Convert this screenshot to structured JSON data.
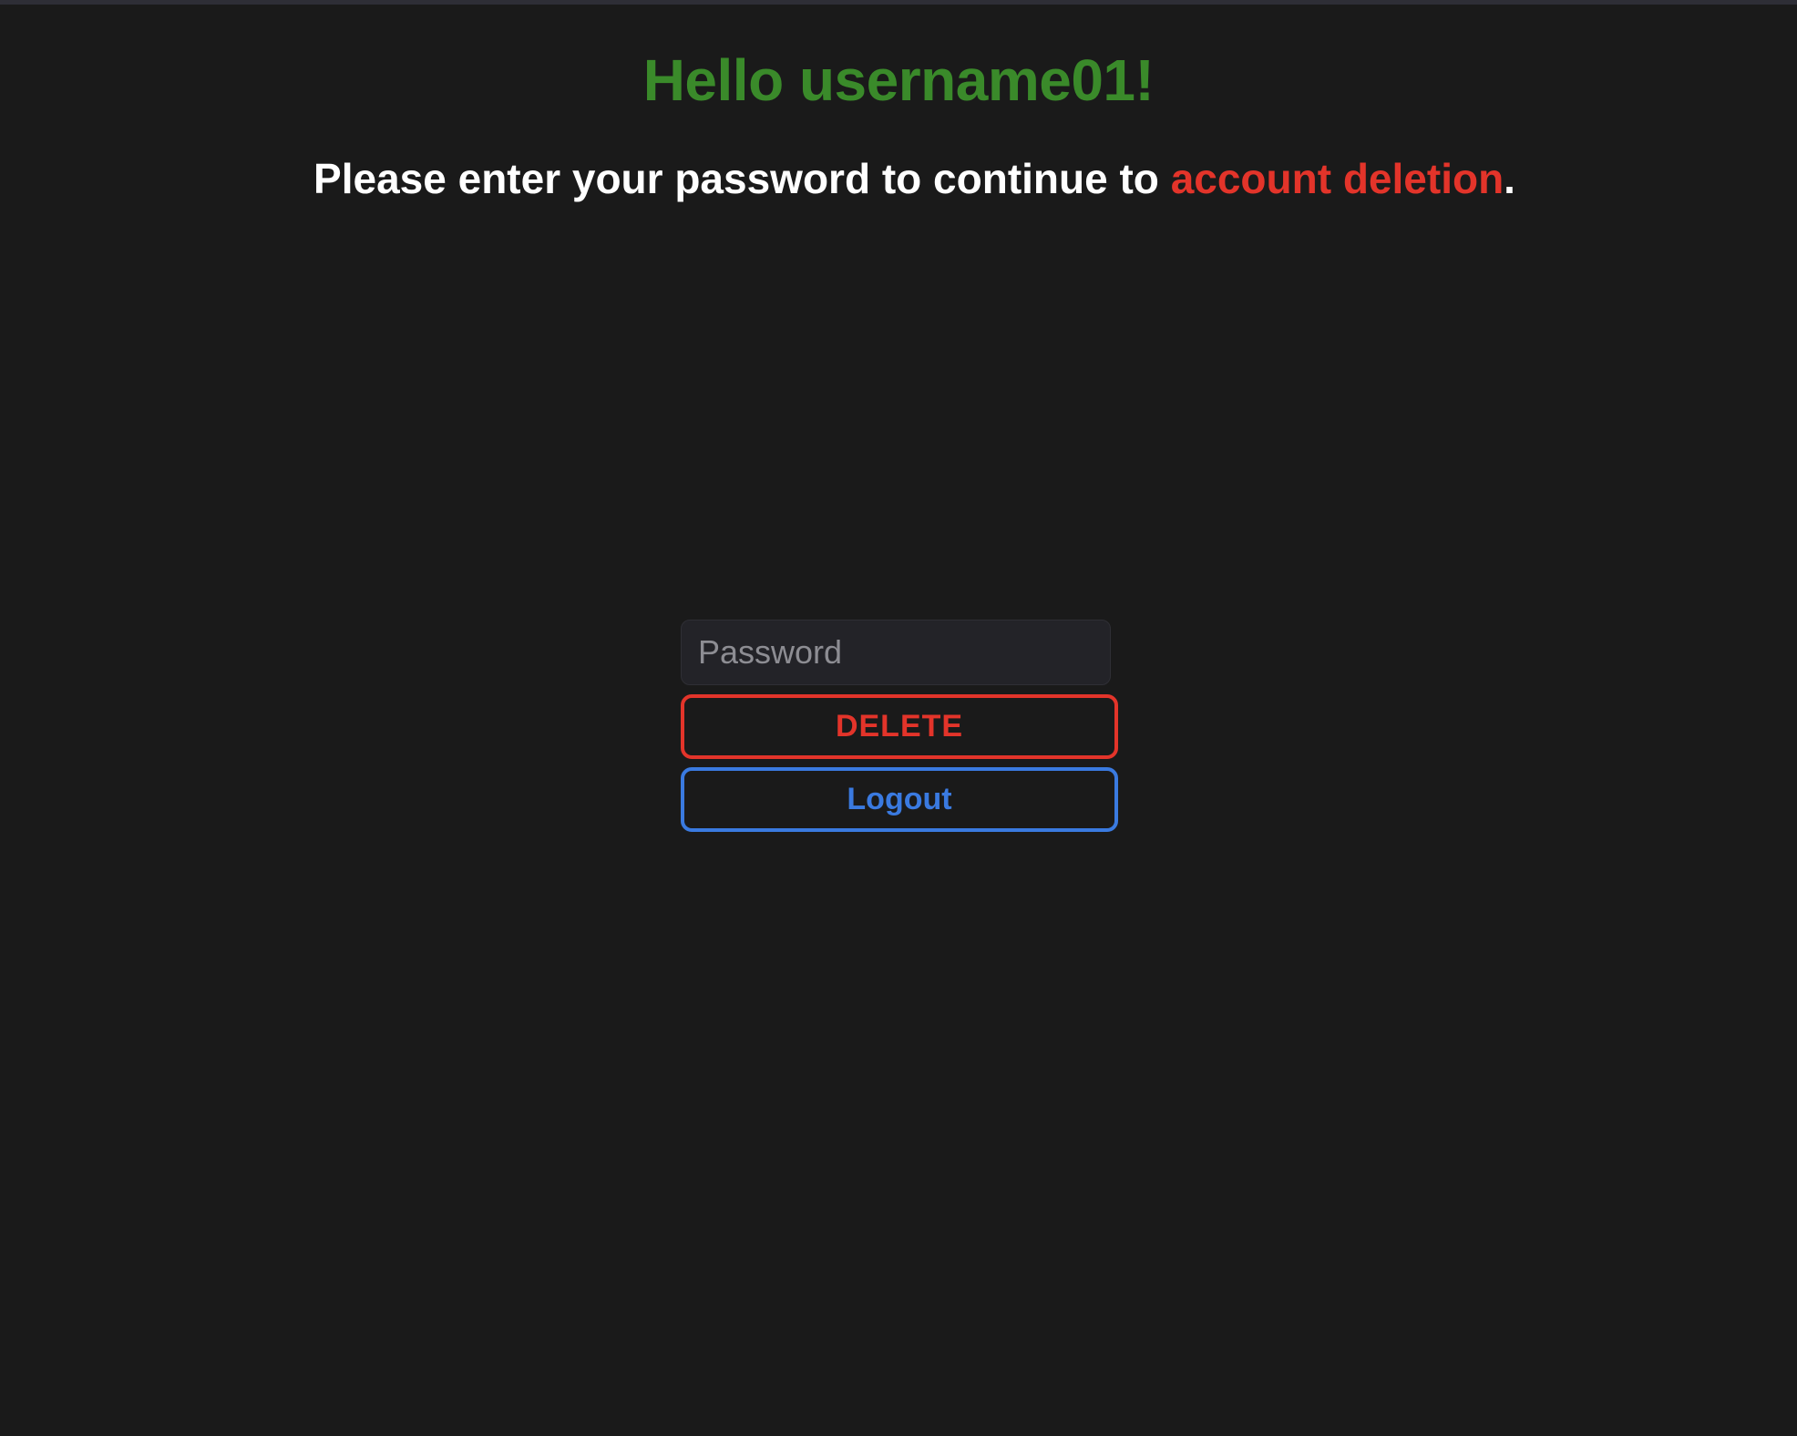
{
  "header": {
    "greeting": "Hello username01!",
    "instruction_prefix": "Please enter your password to continue to ",
    "instruction_highlight": "account deletion",
    "instruction_suffix": "."
  },
  "form": {
    "password_placeholder": "Password",
    "password_value": "",
    "delete_label": "DELETE",
    "logout_label": "Logout"
  },
  "colors": {
    "background": "#1a1a1a",
    "greeting": "#3a8a2a",
    "danger": "#e3342a",
    "primary": "#3a7ae0",
    "text": "#ffffff",
    "input_background": "#232328"
  }
}
